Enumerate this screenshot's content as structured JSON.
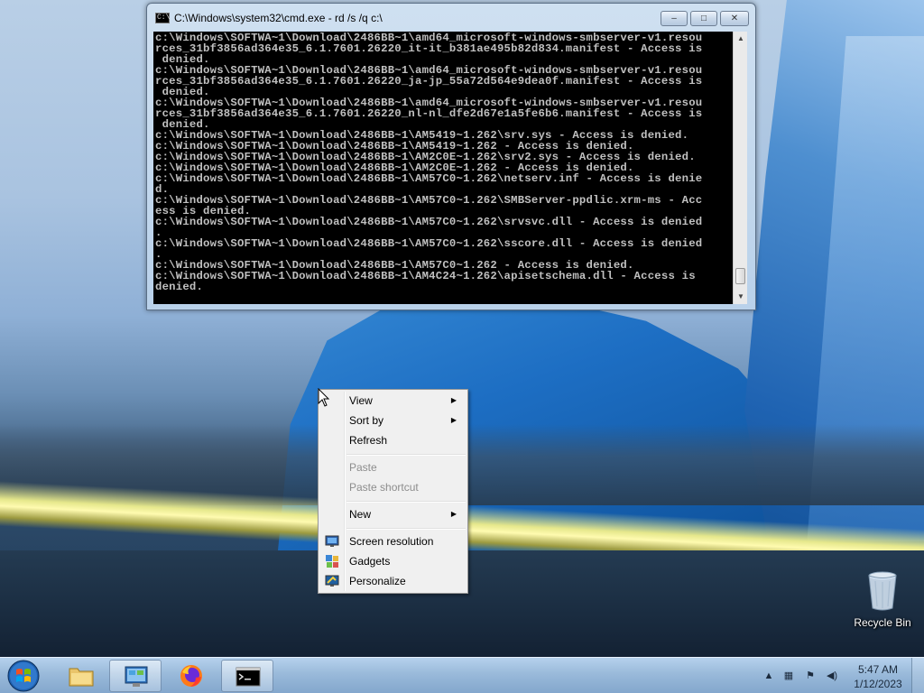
{
  "console_window": {
    "title": "C:\\Windows\\system32\\cmd.exe - rd  /s /q c:\\",
    "title_icon_text": "C:\\",
    "buttons": {
      "minimize": "–",
      "maximize": "□",
      "close": "✕"
    },
    "lines": [
      "c:\\Windows\\SOFTWA~1\\Download\\2486BB~1\\amd64_microsoft-windows-smbserver-v1.resou",
      "rces_31bf3856ad364e35_6.1.7601.26220_it-it_b381ae495b82d834.manifest - Access is",
      " denied.",
      "c:\\Windows\\SOFTWA~1\\Download\\2486BB~1\\amd64_microsoft-windows-smbserver-v1.resou",
      "rces_31bf3856ad364e35_6.1.7601.26220_ja-jp_55a72d564e9dea0f.manifest - Access is",
      " denied.",
      "c:\\Windows\\SOFTWA~1\\Download\\2486BB~1\\amd64_microsoft-windows-smbserver-v1.resou",
      "rces_31bf3856ad364e35_6.1.7601.26220_nl-nl_dfe2d67e1a5fe6b6.manifest - Access is",
      " denied.",
      "c:\\Windows\\SOFTWA~1\\Download\\2486BB~1\\AM5419~1.262\\srv.sys - Access is denied.",
      "c:\\Windows\\SOFTWA~1\\Download\\2486BB~1\\AM5419~1.262 - Access is denied.",
      "c:\\Windows\\SOFTWA~1\\Download\\2486BB~1\\AM2C0E~1.262\\srv2.sys - Access is denied.",
      "c:\\Windows\\SOFTWA~1\\Download\\2486BB~1\\AM2C0E~1.262 - Access is denied.",
      "c:\\Windows\\SOFTWA~1\\Download\\2486BB~1\\AM57C0~1.262\\netserv.inf - Access is denie",
      "d.",
      "c:\\Windows\\SOFTWA~1\\Download\\2486BB~1\\AM57C0~1.262\\SMBServer-ppdlic.xrm-ms - Acc",
      "ess is denied.",
      "c:\\Windows\\SOFTWA~1\\Download\\2486BB~1\\AM57C0~1.262\\srvsvc.dll - Access is denied",
      ".",
      "c:\\Windows\\SOFTWA~1\\Download\\2486BB~1\\AM57C0~1.262\\sscore.dll - Access is denied",
      ".",
      "c:\\Windows\\SOFTWA~1\\Download\\2486BB~1\\AM57C0~1.262 - Access is denied.",
      "c:\\Windows\\SOFTWA~1\\Download\\2486BB~1\\AM4C24~1.262\\apisetschema.dll - Access is",
      "denied."
    ]
  },
  "context_menu": {
    "items": [
      {
        "label": "View",
        "submenu": true,
        "enabled": true
      },
      {
        "label": "Sort by",
        "submenu": true,
        "enabled": true
      },
      {
        "label": "Refresh",
        "submenu": false,
        "enabled": true
      },
      {
        "label": "Paste",
        "submenu": false,
        "enabled": false
      },
      {
        "label": "Paste shortcut",
        "submenu": false,
        "enabled": false
      },
      {
        "label": "New",
        "submenu": true,
        "enabled": true
      },
      {
        "label": "Screen resolution",
        "submenu": false,
        "enabled": true,
        "icon": "monitor-icon"
      },
      {
        "label": "Gadgets",
        "submenu": false,
        "enabled": true,
        "icon": "gadgets-icon"
      },
      {
        "label": "Personalize",
        "submenu": false,
        "enabled": true,
        "icon": "personalize-icon"
      }
    ],
    "arrow_glyph": "▶"
  },
  "desktop": {
    "recycle_bin_label": "Recycle Bin"
  },
  "taskbar": {
    "pinned": [
      "folder-icon",
      "control-panel-icon",
      "firefox-icon",
      "cmd-icon"
    ],
    "tray_glyphs": {
      "chevron": "▲",
      "network": "▦",
      "flag": "⚑",
      "volume": "◀)"
    },
    "clock": {
      "time": "5:47 AM",
      "date": "1/12/2023"
    }
  },
  "colors": {
    "console_bg": "#000000",
    "console_text": "#c0c0c0",
    "menu_bg": "#f0f0f0",
    "disabled_text": "#8d8d8d"
  }
}
